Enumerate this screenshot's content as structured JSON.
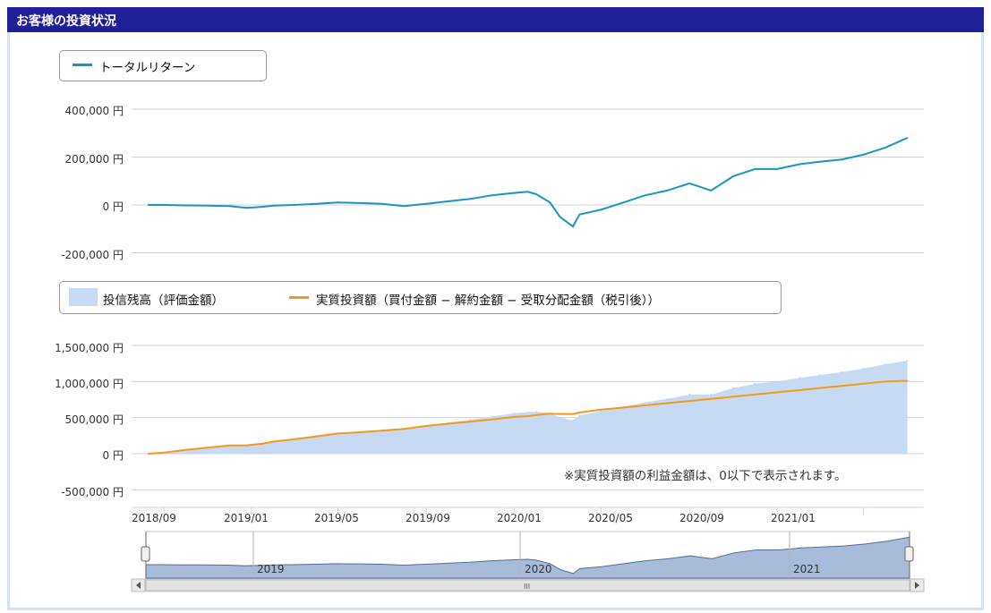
{
  "header": {
    "title": "お客様の投資状況"
  },
  "top_chart": {
    "legend": {
      "series_label": "トータルリターン"
    },
    "y_ticks": [
      "400,000 円",
      "200,000 円",
      "0 円",
      "-200,000 円"
    ]
  },
  "bottom_chart": {
    "legend": {
      "area_label": "投信残高（評価金額）",
      "line_label": "実質投資額（買付金額 − 解約金額 − 受取分配金額（税引後））"
    },
    "y_ticks": [
      "1,500,000 円",
      "1,000,000 円",
      "500,000 円",
      "0 円",
      "-500,000 円"
    ],
    "note": "※実質投資額の利益金額は、0以下で表示されます。"
  },
  "x_ticks": [
    "2018/09",
    "2019/01",
    "2019/05",
    "2019/09",
    "2020/01",
    "2020/05",
    "2020/09",
    "2021/01"
  ],
  "navigator": {
    "labels": [
      "2019",
      "2020",
      "2021"
    ],
    "scroll_grip": "III"
  },
  "colors": {
    "header_bg": "#1f1f9a",
    "return_line": "#1796c0",
    "invest_line": "#f39a1a",
    "balance_area": "#c6daf3",
    "navigator_fill": "#a8bcd9"
  },
  "chart_data": [
    {
      "type": "line",
      "series": [
        {
          "name": "トータルリターン",
          "x": [
            "2018/08/10",
            "2018/09/01",
            "2018/10/01",
            "2018/11/01",
            "2018/12/01",
            "2018/12/25",
            "2019/01/15",
            "2019/02/01",
            "2019/03/01",
            "2019/04/01",
            "2019/05/01",
            "2019/06/01",
            "2019/07/01",
            "2019/08/01",
            "2019/09/01",
            "2019/10/01",
            "2019/11/01",
            "2019/12/01",
            "2020/01/01",
            "2020/01/20",
            "2020/02/01",
            "2020/02/20",
            "2020/03/05",
            "2020/03/23",
            "2020/04/01",
            "2020/05/01",
            "2020/06/01",
            "2020/07/01",
            "2020/08/01",
            "2020/09/01",
            "2020/10/01",
            "2020/11/01",
            "2020/12/01",
            "2021/01/01",
            "2021/02/01",
            "2021/03/01",
            "2021/04/01",
            "2021/05/01",
            "2021/06/01",
            "2021/07/01"
          ],
          "values": [
            0,
            0,
            -2000,
            -3000,
            -5000,
            -12000,
            -8000,
            -3000,
            0,
            5000,
            10000,
            8000,
            5000,
            -5000,
            5000,
            15000,
            25000,
            40000,
            50000,
            55000,
            45000,
            10000,
            -50000,
            -90000,
            -40000,
            -20000,
            10000,
            40000,
            60000,
            90000,
            60000,
            120000,
            150000,
            150000,
            170000,
            180000,
            190000,
            210000,
            240000,
            280000
          ]
        }
      ],
      "ylim": [
        -200000,
        400000
      ]
    },
    {
      "type": "area",
      "series": [
        {
          "name": "投信残高（評価金額）",
          "x": [
            "2018/08/10",
            "2018/09/01",
            "2018/10/01",
            "2018/11/01",
            "2018/12/01",
            "2018/12/25",
            "2019/01/15",
            "2019/02/01",
            "2019/03/01",
            "2019/04/01",
            "2019/05/01",
            "2019/06/01",
            "2019/07/01",
            "2019/08/01",
            "2019/09/01",
            "2019/10/01",
            "2019/11/01",
            "2019/12/01",
            "2020/01/01",
            "2020/01/20",
            "2020/02/01",
            "2020/02/20",
            "2020/03/05",
            "2020/03/23",
            "2020/04/01",
            "2020/05/01",
            "2020/06/01",
            "2020/07/01",
            "2020/08/01",
            "2020/09/01",
            "2020/10/01",
            "2020/11/01",
            "2020/12/01",
            "2021/01/01",
            "2021/02/01",
            "2021/03/01",
            "2021/04/01",
            "2021/05/01",
            "2021/06/01",
            "2021/07/01"
          ],
          "values": [
            0,
            15000,
            50000,
            80000,
            110000,
            105000,
            130000,
            165000,
            200000,
            245000,
            290000,
            305000,
            325000,
            340000,
            390000,
            430000,
            470000,
            515000,
            560000,
            575000,
            580000,
            565000,
            500000,
            460000,
            530000,
            590000,
            650000,
            710000,
            760000,
            820000,
            820000,
            910000,
            970000,
            1000000,
            1050000,
            1090000,
            1130000,
            1180000,
            1240000,
            1290000
          ]
        },
        {
          "name": "実質投資額（買付金額 − 解約金額 − 受取分配金額（税引後））",
          "x": [
            "2018/08/10",
            "2018/09/01",
            "2018/10/01",
            "2018/11/01",
            "2018/12/01",
            "2018/12/25",
            "2019/01/15",
            "2019/02/01",
            "2019/03/01",
            "2019/04/01",
            "2019/05/01",
            "2019/06/01",
            "2019/07/01",
            "2019/08/01",
            "2019/09/01",
            "2019/10/01",
            "2019/11/01",
            "2019/12/01",
            "2020/01/01",
            "2020/01/20",
            "2020/02/01",
            "2020/02/20",
            "2020/03/05",
            "2020/03/23",
            "2020/04/01",
            "2020/05/01",
            "2020/06/01",
            "2020/07/01",
            "2020/08/01",
            "2020/09/01",
            "2020/10/01",
            "2020/11/01",
            "2020/12/01",
            "2021/01/01",
            "2021/02/01",
            "2021/03/01",
            "2021/04/01",
            "2021/05/01",
            "2021/06/01",
            "2021/07/01"
          ],
          "values": [
            0,
            15000,
            52000,
            83000,
            115000,
            117000,
            138000,
            168000,
            200000,
            240000,
            280000,
            297000,
            320000,
            345000,
            385000,
            415000,
            445000,
            475000,
            510000,
            520000,
            535000,
            555000,
            550000,
            550000,
            570000,
            610000,
            640000,
            670000,
            700000,
            730000,
            760000,
            790000,
            820000,
            850000,
            880000,
            910000,
            940000,
            970000,
            1000000,
            1010000
          ]
        }
      ],
      "ylim": [
        -500000,
        1500000
      ]
    }
  ]
}
